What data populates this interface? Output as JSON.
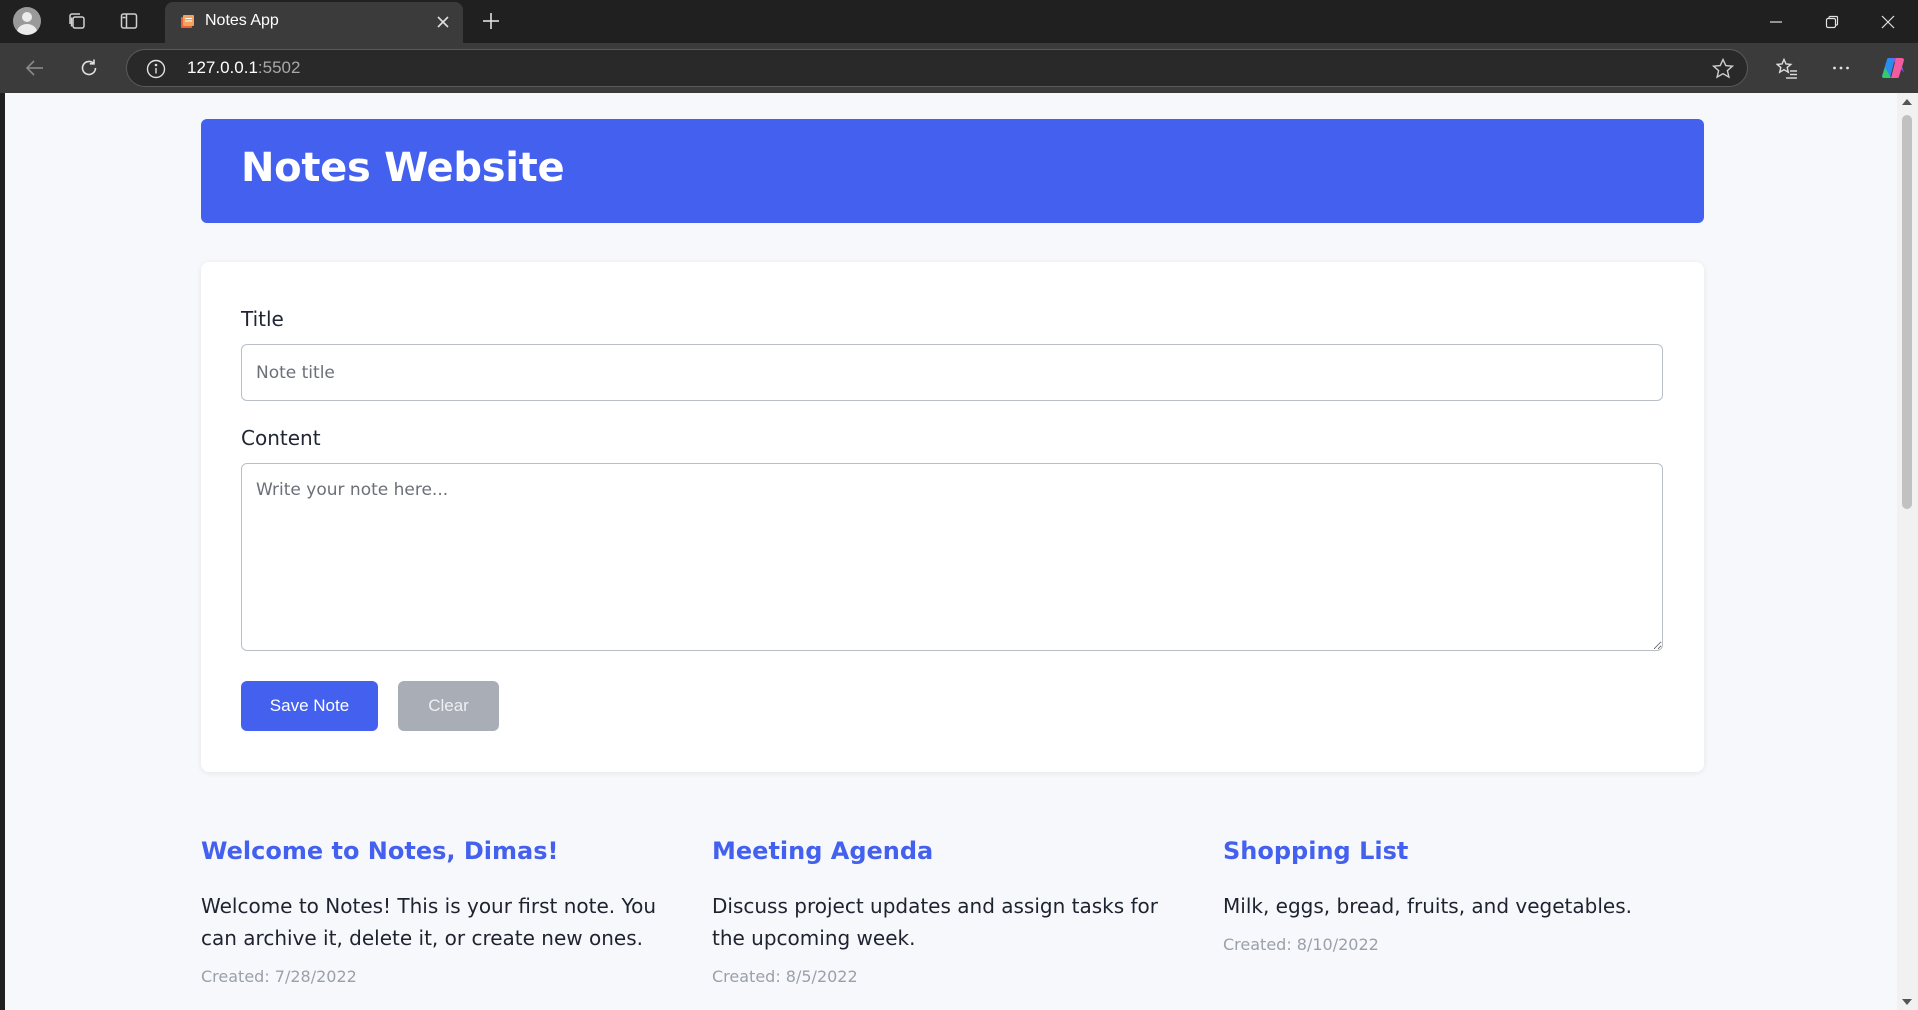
{
  "browser": {
    "tab_title": "Notes App",
    "url_host": "127.0.0.1",
    "url_port": ":5502",
    "icons": {
      "profile": "avatar-icon",
      "collections": "collections-icon",
      "side_panel": "side-panel-icon",
      "new_tab": "plus-icon",
      "close_tab": "close-icon",
      "back": "arrow-left-icon",
      "reload": "reload-icon",
      "site_info": "info-icon",
      "favorite": "star-icon",
      "favorites": "favorites-list-icon",
      "more": "ellipsis-icon",
      "copilot": "copilot-icon"
    }
  },
  "header": {
    "title": "Notes Website"
  },
  "form": {
    "title_label": "Title",
    "title_value": "",
    "title_placeholder": "Note title",
    "content_label": "Content",
    "content_value": "",
    "content_placeholder": "Write your note here...",
    "save_label": "Save Note",
    "clear_label": "Clear"
  },
  "notes": [
    {
      "title": "Welcome to Notes, Dimas!",
      "content": "Welcome to Notes! This is your first note. You can archive it, delete it, or create new ones.",
      "created": "Created: 7/28/2022"
    },
    {
      "title": "Meeting Agenda",
      "content": "Discuss project updates and assign tasks for the upcoming week.",
      "created": "Created: 8/5/2022"
    },
    {
      "title": "Shopping List",
      "content": "Milk, eggs, bread, fruits, and vegetables.",
      "created": "Created: 8/10/2022"
    }
  ],
  "colors": {
    "accent": "#4361ee",
    "clear_button": "#a8adb6",
    "page_background": "#f7f8fb",
    "note_date": "#9aa0aa"
  }
}
